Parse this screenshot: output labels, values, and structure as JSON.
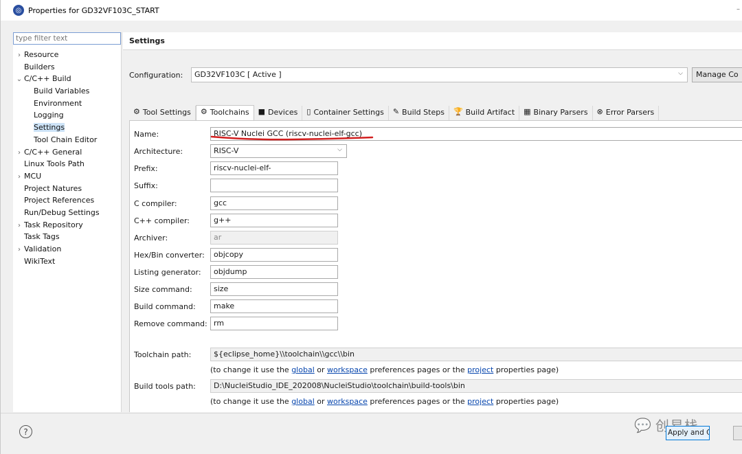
{
  "window": {
    "title": "Properties for GD32VF103C_START",
    "app_icon": "eclipse-icon"
  },
  "sidebar": {
    "filter_placeholder": "type filter text",
    "items": [
      {
        "label": "Resource",
        "expander": "›",
        "indent": 0
      },
      {
        "label": "Builders",
        "expander": "",
        "indent": 0
      },
      {
        "label": "C/C++ Build",
        "expander": "⌄",
        "indent": 0
      },
      {
        "label": "Build Variables",
        "expander": "",
        "indent": 1
      },
      {
        "label": "Environment",
        "expander": "",
        "indent": 1
      },
      {
        "label": "Logging",
        "expander": "",
        "indent": 1
      },
      {
        "label": "Settings",
        "expander": "",
        "indent": 1,
        "selected": true
      },
      {
        "label": "Tool Chain Editor",
        "expander": "",
        "indent": 1
      },
      {
        "label": "C/C++ General",
        "expander": "›",
        "indent": 0
      },
      {
        "label": "Linux Tools Path",
        "expander": "",
        "indent": 0
      },
      {
        "label": "MCU",
        "expander": "›",
        "indent": 0
      },
      {
        "label": "Project Natures",
        "expander": "",
        "indent": 0
      },
      {
        "label": "Project References",
        "expander": "",
        "indent": 0
      },
      {
        "label": "Run/Debug Settings",
        "expander": "",
        "indent": 0
      },
      {
        "label": "Task Repository",
        "expander": "›",
        "indent": 0
      },
      {
        "label": "Task Tags",
        "expander": "",
        "indent": 0
      },
      {
        "label": "Validation",
        "expander": "›",
        "indent": 0
      },
      {
        "label": "WikiText",
        "expander": "",
        "indent": 0
      }
    ]
  },
  "main": {
    "header": "Settings",
    "configuration": {
      "label": "Configuration:",
      "value": "GD32VF103C  [ Active ]",
      "manage_label": "Manage Co"
    },
    "tabs": [
      {
        "label": "Tool Settings",
        "icon": "⚙",
        "icon_name": "tool-settings-icon"
      },
      {
        "label": "Toolchains",
        "icon": "⚙",
        "icon_name": "toolchains-icon",
        "active": true
      },
      {
        "label": "Devices",
        "icon": "■",
        "icon_name": "devices-icon"
      },
      {
        "label": "Container Settings",
        "icon": "▯",
        "icon_name": "container-settings-icon"
      },
      {
        "label": "Build Steps",
        "icon": "✎",
        "icon_name": "build-steps-icon"
      },
      {
        "label": "Build Artifact",
        "icon": "🏆",
        "icon_name": "build-artifact-icon"
      },
      {
        "label": "Binary Parsers",
        "icon": "▦",
        "icon_name": "binary-parsers-icon"
      },
      {
        "label": "Error Parsers",
        "icon": "⊗",
        "icon_name": "error-parsers-icon"
      }
    ],
    "toolchain": {
      "name_label": "Name:",
      "name_value": "RISC-V Nuclei GCC (riscv-nuclei-elf-gcc)",
      "architecture_label": "Architecture:",
      "architecture_value": "RISC-V",
      "prefix_label": "Prefix:",
      "prefix_value": "riscv-nuclei-elf-",
      "suffix_label": "Suffix:",
      "suffix_value": "",
      "c_compiler_label": "C compiler:",
      "c_compiler_value": "gcc",
      "cpp_compiler_label": "C++ compiler:",
      "cpp_compiler_value": "g++",
      "archiver_label": "Archiver:",
      "archiver_value": "ar",
      "hexbin_label": "Hex/Bin converter:",
      "hexbin_value": "objcopy",
      "listing_label": "Listing generator:",
      "listing_value": "objdump",
      "size_label": "Size command:",
      "size_value": "size",
      "build_label": "Build command:",
      "build_value": "make",
      "remove_label": "Remove command:",
      "remove_value": "rm",
      "toolchain_path_label": "Toolchain path:",
      "toolchain_path_value": "${eclipse_home}\\\\toolchain\\\\gcc\\\\bin",
      "build_tools_path_label": "Build tools path:",
      "build_tools_path_value": "D:\\NucleiStudio_IDE_202008\\NucleiStudio\\toolchain\\build-tools\\bin",
      "hint_prefix": "(to change it use the ",
      "hint_global": "global",
      "hint_or": " or ",
      "hint_workspace": "workspace",
      "hint_middle": " preferences pages or the ",
      "hint_project": "project",
      "hint_suffix": " properties page)"
    }
  },
  "footer": {
    "help_label": "?",
    "apply_close_label": "Apply and Close",
    "watermark": "创易栈",
    "annotation_color": "#d21f1f"
  }
}
